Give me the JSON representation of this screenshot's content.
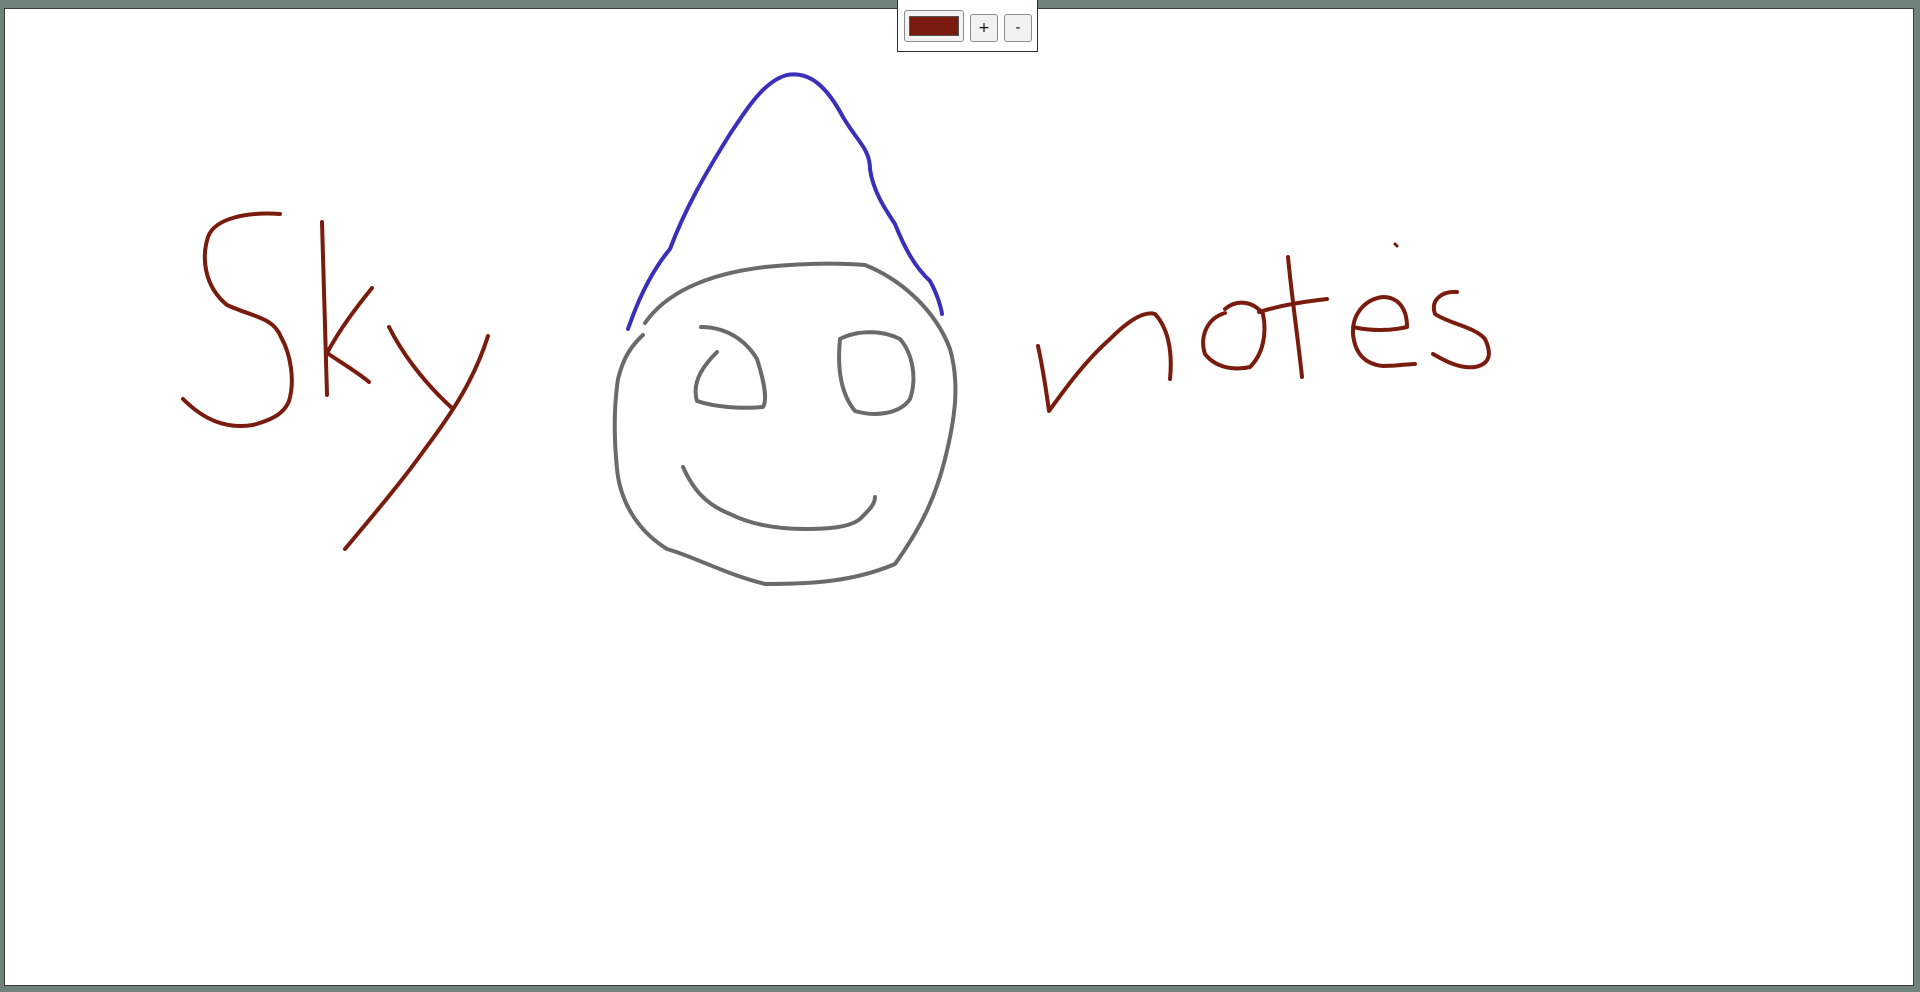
{
  "toolbar": {
    "current_color": "#7a1c0d",
    "color_button_icon": "color-swatch-icon",
    "increase_label": "+",
    "decrease_label": "-"
  },
  "drawing": {
    "handwritten_word_left": "Sky",
    "handwritten_word_right": "notes",
    "stroke_colors": {
      "text": "#7a1c0d",
      "hat": "#3a2fb8",
      "face": "#6a6a6a"
    }
  }
}
